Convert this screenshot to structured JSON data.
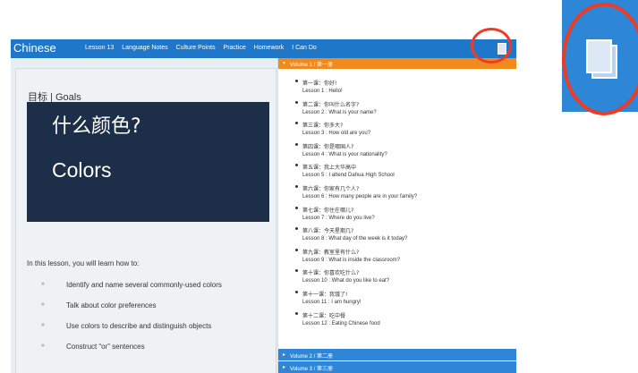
{
  "app": {
    "brand": "Chinese",
    "nav": [
      "Lesson 13",
      "Language Notes",
      "Culture Points",
      "Practice",
      "Homework",
      "I Can Do"
    ]
  },
  "left": {
    "goals_title": "目标 | Goals",
    "hero_cn": "什么颜色?",
    "hero_en": "Colors",
    "intro": "In this lesson, you will learn how to:",
    "goals": [
      "Identify and name several commonly-used colors",
      "Talk about color preferences",
      "Use colors to describe and distinguish objects",
      "Construct “or” sentences"
    ]
  },
  "right": {
    "volume1": "Volume 1 / 第一册",
    "lessons": [
      {
        "cn": "第一课：你好!",
        "en": "Lesson 1 : Hello!"
      },
      {
        "cn": "第二课：你叫什么名字?",
        "en": "Lesson 2 : What is your name?"
      },
      {
        "cn": "第三课：你多大?",
        "en": "Lesson 3 : How old are you?"
      },
      {
        "cn": "第四课：你是哪国人?",
        "en": "Lesson 4 : What is your nationality?"
      },
      {
        "cn": "第五课：我上大华高中",
        "en": "Lesson 5 : I attend Dahua High School"
      },
      {
        "cn": "第六课：你家有几个人?",
        "en": "Lesson 6 : How many people are in your family?"
      },
      {
        "cn": "第七课：你住在哪儿?",
        "en": "Lesson 7 : Where do you live?"
      },
      {
        "cn": "第八课：今天星期几?",
        "en": "Lesson 8 : What day of the week is it today?"
      },
      {
        "cn": "第九课：教室里有什么?",
        "en": "Lesson 9 : What is inside the classroom?"
      },
      {
        "cn": "第十课：你喜欢吃什么?",
        "en": "Lesson 10 : What do you like to eat?"
      },
      {
        "cn": "第十一课：我饿了!",
        "en": "Lesson 11 : I am hungry!"
      },
      {
        "cn": "第十二课：吃中餐",
        "en": "Lesson 12 : Eating Chinese food"
      }
    ],
    "volume2": "Volume 2 / 第二册",
    "volume3": "Volume 3 / 第三册"
  },
  "icons": {
    "book": "book-icon",
    "collapse": "chevron-down-icon",
    "expand": "chevron-right-icon"
  },
  "colors": {
    "topbar": "#1f77c9",
    "active_volume": "#f18a1c",
    "hero": "#1d2f48",
    "highlight": "#ef3b23"
  }
}
